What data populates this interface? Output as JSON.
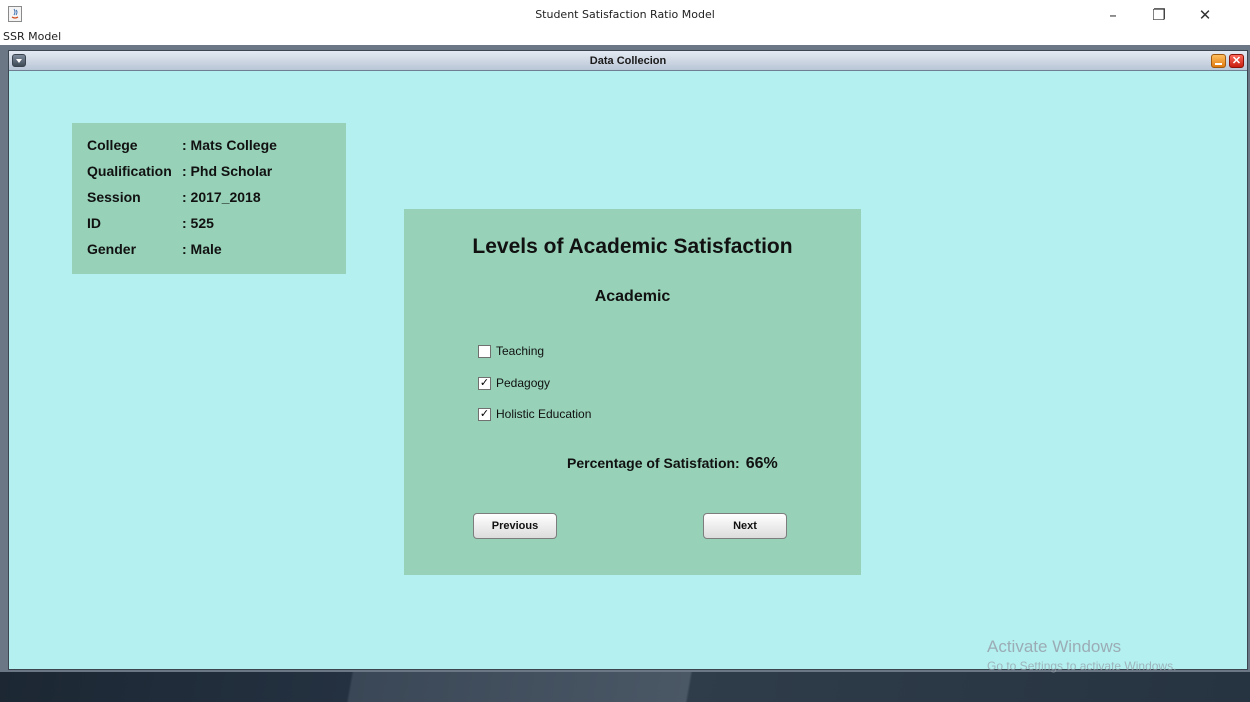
{
  "window": {
    "title": "Student Satisfaction Ratio Model",
    "min_glyph": "–",
    "max_glyph": "❐",
    "close_glyph": "✕",
    "icon": "java-app-icon"
  },
  "menubar": {
    "items": [
      {
        "label": "SSR Model"
      }
    ]
  },
  "frame": {
    "title": "Data Collecion",
    "close_glyph": "✕"
  },
  "info": {
    "rows": [
      {
        "key": "College",
        "value": ": Mats College"
      },
      {
        "key": "Qualification",
        "value": ": Phd Scholar"
      },
      {
        "key": "Session",
        "value": ": 2017_2018"
      },
      {
        "key": "ID",
        "value": ": 525"
      },
      {
        "key": "Gender",
        "value": ": Male"
      }
    ]
  },
  "panel": {
    "heading": "Levels of Academic Satisfaction",
    "subheading": "Academic",
    "options": [
      {
        "label": "Teaching",
        "checked": false,
        "mark": ""
      },
      {
        "label": "Pedagogy",
        "checked": true,
        "mark": "✓"
      },
      {
        "label": "Holistic Education",
        "checked": true,
        "mark": "✓"
      }
    ],
    "percent_label": "Percentage of Satisfation:",
    "percent_value": "66%",
    "previous_label": "Previous",
    "next_label": "Next"
  },
  "watermark": {
    "title": "Activate Windows",
    "subtitle": "Go to Settings to activate Windows."
  },
  "colors": {
    "frame_bg": "#b4f0f0",
    "panel_bg": "#96d1b8"
  }
}
